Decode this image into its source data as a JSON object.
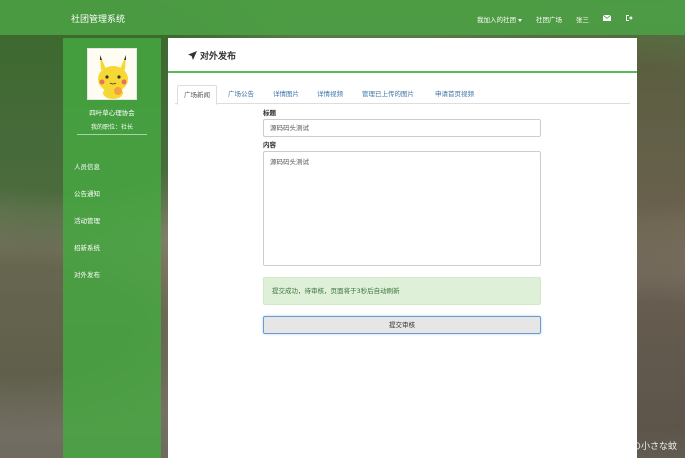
{
  "navbar": {
    "brand": "社团管理系统",
    "my_clubs": "我加入的社团",
    "plaza": "社团广场",
    "user": "张三"
  },
  "sidebar": {
    "org_name": "四叶草心理协会",
    "role": "我的职位：社长",
    "items": [
      {
        "label": "人员信息"
      },
      {
        "label": "公告通知"
      },
      {
        "label": "活动管理"
      },
      {
        "label": "招新系统"
      },
      {
        "label": "对外发布"
      }
    ]
  },
  "main": {
    "title": "对外发布",
    "tabs": [
      {
        "label": "广场新闻",
        "active": true
      },
      {
        "label": "广场公告"
      },
      {
        "label": "详情图片"
      },
      {
        "label": "详情视频"
      },
      {
        "label": "管理已上传的图片"
      },
      {
        "label": "申请首页视频"
      }
    ],
    "form": {
      "title_label": "标题",
      "title_value": "源码码头测试",
      "content_label": "内容",
      "content_value": "源码码头测试",
      "alert": "提交成功，待审核，页面将于3秒后自动刷新",
      "submit_label": "提交审核"
    }
  },
  "watermark": "CSDN @无敌の小さな蚊",
  "colors": {
    "accent": "#5cb85c",
    "navbar": "#4ca046",
    "sidebar": "#46aa41",
    "link": "#3c73a8"
  }
}
